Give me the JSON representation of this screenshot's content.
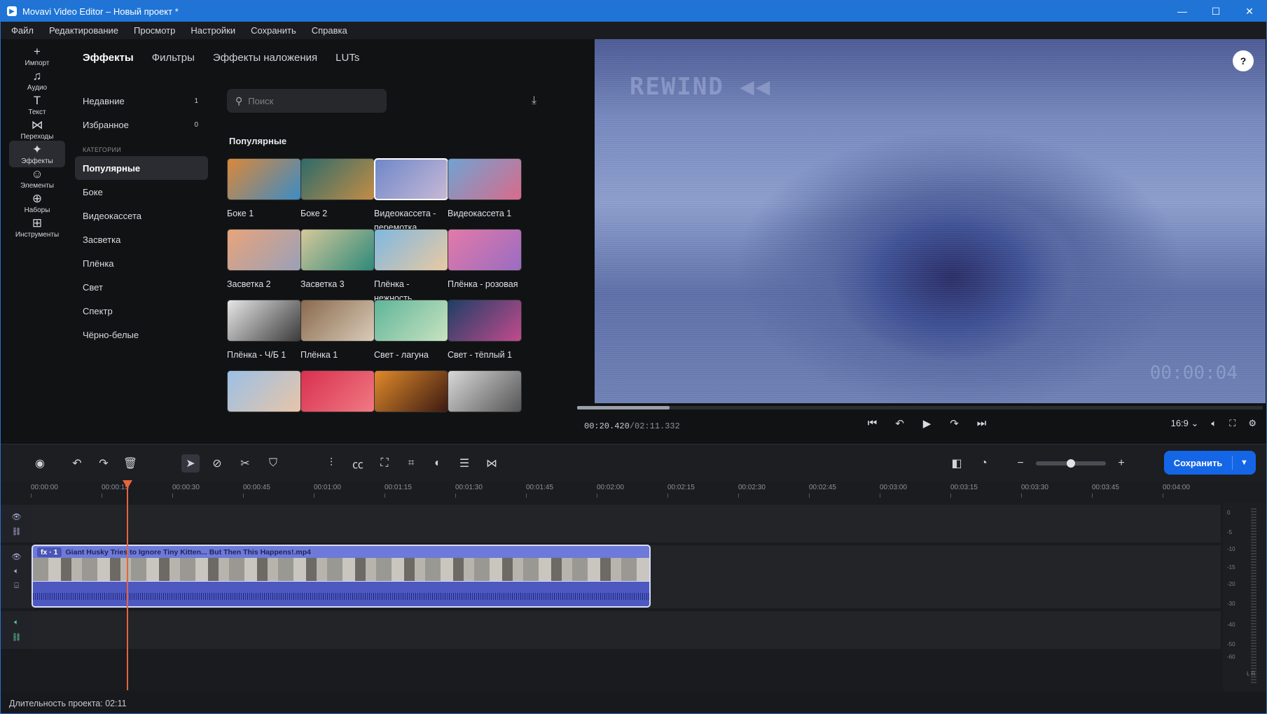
{
  "window": {
    "title": "Movavi Video Editor – Новый проект *",
    "controls": [
      "minimize-icon",
      "maximize-icon",
      "close-icon"
    ]
  },
  "menu": [
    "Файл",
    "Редактирование",
    "Просмотр",
    "Настройки",
    "Сохранить",
    "Справка"
  ],
  "tools": [
    {
      "label": "Импорт",
      "icon": "+"
    },
    {
      "label": "Аудио",
      "icon": "♫"
    },
    {
      "label": "Текст",
      "icon": "T"
    },
    {
      "label": "Переходы",
      "icon": "⋈"
    },
    {
      "label": "Эффекты",
      "icon": "✦"
    },
    {
      "label": "Элементы",
      "icon": "☺"
    },
    {
      "label": "Наборы",
      "icon": "⊕"
    },
    {
      "label": "Инструменты",
      "icon": "⊞"
    }
  ],
  "active_tool": "Эффекты",
  "tabs": [
    "Эффекты",
    "Фильтры",
    "Эффекты наложения",
    "LUTs"
  ],
  "active_tab": "Эффекты",
  "sidebar": {
    "recent": {
      "label": "Недавние",
      "count": "1"
    },
    "favorites": {
      "label": "Избранное",
      "count": "0"
    },
    "categories_header": "КАТЕГОРИИ",
    "categories": [
      "Популярные",
      "Боке",
      "Видеокассета",
      "Засветка",
      "Плёнка",
      "Свет",
      "Спектр",
      "Чёрно-белые"
    ],
    "active_category": "Популярные"
  },
  "search": {
    "placeholder": "Поиск"
  },
  "section_title": "Популярные",
  "effects": [
    {
      "title": "Боке 1",
      "colors": [
        "#d9883a",
        "#3c8cc4"
      ]
    },
    {
      "title": "Боке 2",
      "colors": [
        "#2d6b6a",
        "#c38d46"
      ]
    },
    {
      "title": "Видеокассета - перемотка",
      "colors": [
        "#6f88c9",
        "#c7b8d6"
      ],
      "selected": true
    },
    {
      "title": "Видеокассета 1",
      "colors": [
        "#6fa3d3",
        "#d96b8a"
      ]
    },
    {
      "title": "Засветка 2",
      "colors": [
        "#e8a47b",
        "#9aa0b8"
      ]
    },
    {
      "title": "Засветка 3",
      "colors": [
        "#d6c89a",
        "#2d8a7a"
      ]
    },
    {
      "title": "Плёнка - нежность",
      "colors": [
        "#7fb8e0",
        "#e9c9a3"
      ]
    },
    {
      "title": "Плёнка - розовая",
      "colors": [
        "#e37aa8",
        "#9a6cc2"
      ]
    },
    {
      "title": "Плёнка - Ч/Б 1",
      "colors": [
        "#e6e6e6",
        "#3b3b3b"
      ]
    },
    {
      "title": "Плёнка 1",
      "colors": [
        "#8a6a4d",
        "#d8cbb8"
      ]
    },
    {
      "title": "Свет - лагуна",
      "colors": [
        "#5fb59a",
        "#c8e3c0"
      ]
    },
    {
      "title": "Свет - тёплый 1",
      "colors": [
        "#1e3f66",
        "#c24a8d"
      ]
    },
    {
      "title": "",
      "colors": [
        "#9bc0e6",
        "#e7c5a8"
      ]
    },
    {
      "title": "",
      "colors": [
        "#d9304f",
        "#f07a83"
      ]
    },
    {
      "title": "",
      "colors": [
        "#e08a2a",
        "#3b1a12"
      ]
    },
    {
      "title": "",
      "colors": [
        "#d8d8d8",
        "#555555"
      ]
    }
  ],
  "preview": {
    "osd_top": "REWIND ◀◀",
    "osd_bottom": "00:00:04",
    "current_time": "00:20.420",
    "total_time": "/02:11.332",
    "progress": 0.135,
    "aspect": "16:9",
    "help": "?"
  },
  "timeline": {
    "save_label": "Сохранить",
    "zoom": 0.5,
    "ruler": [
      "00:00:00",
      "00:00:15",
      "00:00:30",
      "00:00:45",
      "00:01:00",
      "00:01:15",
      "00:01:30",
      "00:01:45",
      "00:02:00",
      "00:02:15",
      "00:02:30",
      "00:02:45",
      "00:03:00",
      "00:03:15",
      "00:03:30",
      "00:03:45",
      "00:04:00"
    ],
    "clip": {
      "fx": "fx · 1",
      "name": "Giant Husky Tries to Ignore Tiny Kitten... But Then This Happens!.mp4"
    },
    "meter_scale": [
      "0",
      "-5",
      "-10",
      "-15",
      "-20",
      "-30",
      "-40",
      "-50",
      "-60"
    ],
    "meter_channels": "L  R"
  },
  "status": "Длительность проекта: 02:11"
}
